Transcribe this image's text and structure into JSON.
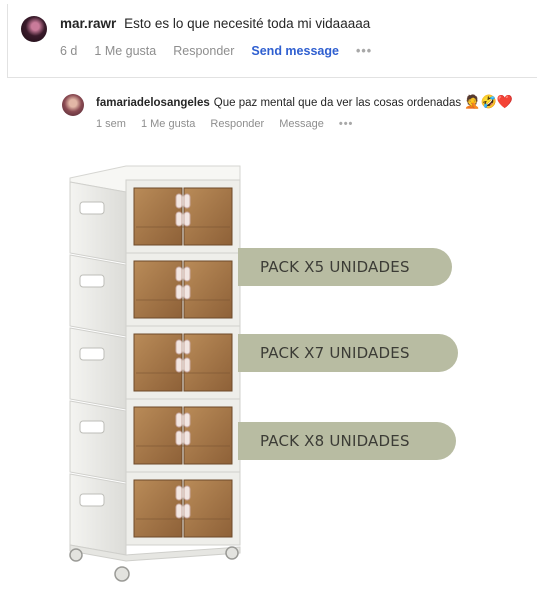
{
  "comment": {
    "username": "mar.rawr",
    "text": "Esto es lo que necesité toda mi vidaaaaa",
    "time": "6 d",
    "likes": "1 Me gusta",
    "reply": "Responder",
    "send": "Send message",
    "more": "•••"
  },
  "reply": {
    "username": "famariadelosangeles",
    "text": "Que paz mental que da ver las cosas ordenadas",
    "emojis": "🤦🤣",
    "heart": "❤️",
    "time": "1 sem",
    "likes": "1 Me gusta",
    "reply": "Responder",
    "message": "Message",
    "more": "•••"
  },
  "packs": [
    {
      "label": "PACK X5 UNIDADES"
    },
    {
      "label": "PACK X7 UNIDADES"
    },
    {
      "label": "PACK X8 UNIDADES"
    }
  ],
  "colors": {
    "pill": "#b8bca2",
    "send_link": "#2f5fd0",
    "meta_gray": "#8e8e8e",
    "drawer_door": "#a97a4a",
    "cabinet_frame": "#eeeeea"
  },
  "icons": {
    "comment_avatar": "user-avatar",
    "reply_avatar": "user-avatar",
    "more": "ellipsis-icon",
    "product": "storage-cabinet-image"
  }
}
